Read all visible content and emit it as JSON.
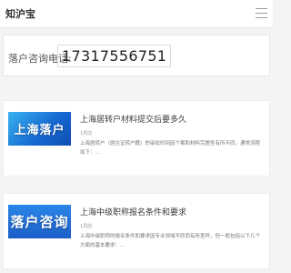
{
  "header": {
    "brand": "知沪宝",
    "menu_icon": "menu-icon"
  },
  "contact": {
    "label": "落户咨询电话:",
    "phone": "17317556751"
  },
  "articles": [
    {
      "thumbnail_text": "上海落户",
      "title": "上海居转户材料提交后要多久",
      "meta": "1周前",
      "excerpt": "上海居转户（居住证转户籍）的审批时间因个案和材料完整性有所不同。通常流程如下：..."
    },
    {
      "thumbnail_text": "落户咨询",
      "title": "上海中级职称报名条件和要求",
      "meta": "1周前",
      "excerpt": "上海中级职称的报名条件和要求因专业领域不同而有所差异，但一般包括以下几个方面的基本要求：..."
    }
  ]
}
